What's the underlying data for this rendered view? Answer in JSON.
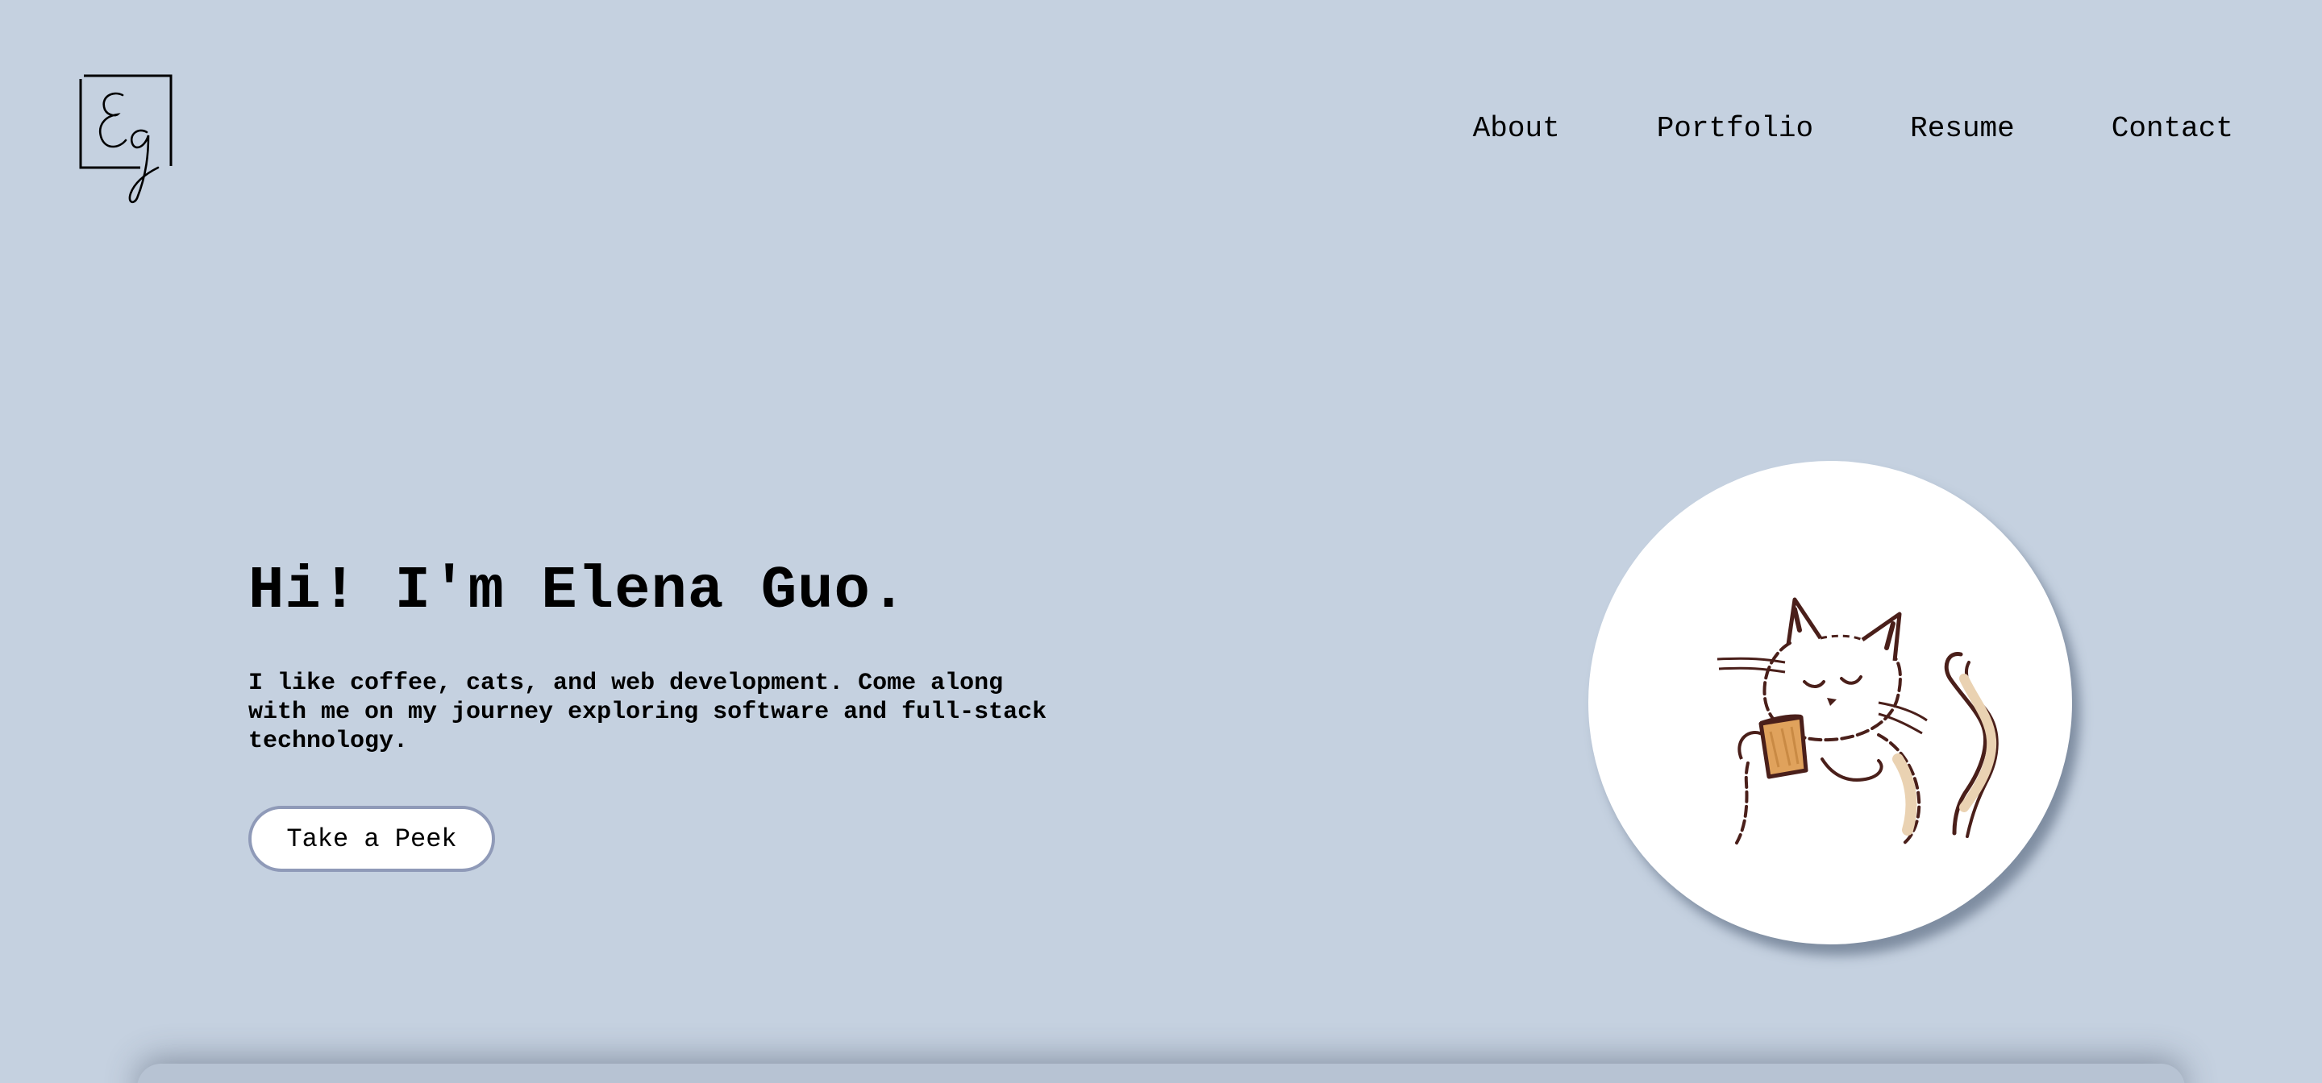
{
  "logo": {
    "alt": "Eg",
    "icon": "eg-signature-logo"
  },
  "nav": {
    "items": [
      {
        "label": "About"
      },
      {
        "label": "Portfolio"
      },
      {
        "label": "Resume"
      },
      {
        "label": "Contact"
      }
    ]
  },
  "hero": {
    "title": "Hi! I'm Elena Guo.",
    "description": "I like coffee, cats, and web development. Come along with me on my journey exploring software and full-stack technology.",
    "cta_label": "Take a Peek"
  },
  "avatar": {
    "icon": "cat-drinking-coffee-illustration"
  },
  "colors": {
    "background": "#c5d1e0",
    "button_border": "#8f9ab8",
    "cat_outline": "#4a1f1a",
    "cup_fill": "#e0a25c",
    "cat_patch": "#ead2b2"
  }
}
